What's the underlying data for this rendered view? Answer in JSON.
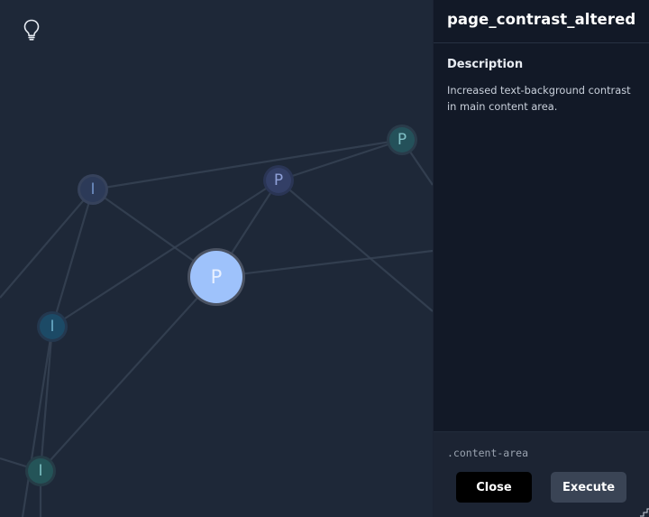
{
  "graph": {
    "nodes": [
      {
        "id": "n1",
        "label": "I",
        "kind": "i-blue"
      },
      {
        "id": "n2",
        "label": "P",
        "kind": "p-purple"
      },
      {
        "id": "n3",
        "label": "P",
        "kind": "p-teal"
      },
      {
        "id": "n4",
        "label": "P",
        "kind": "selected"
      },
      {
        "id": "n5",
        "label": "I",
        "kind": "i-teal-blue"
      },
      {
        "id": "n6",
        "label": "I",
        "kind": "i-teal"
      }
    ],
    "colors": {
      "background": "#1e2838",
      "edge": "#3a4557",
      "selected_fill": "#9ec2fb",
      "selected_ring": "#4a5262"
    }
  },
  "hint": {
    "icon": "lightbulb-icon"
  },
  "panel": {
    "title": "page_contrast_altered",
    "description_heading": "Description",
    "description": "Increased text-background contrast in main content area.",
    "selector": ".content-area",
    "close_label": "Close",
    "execute_label": "Execute"
  }
}
